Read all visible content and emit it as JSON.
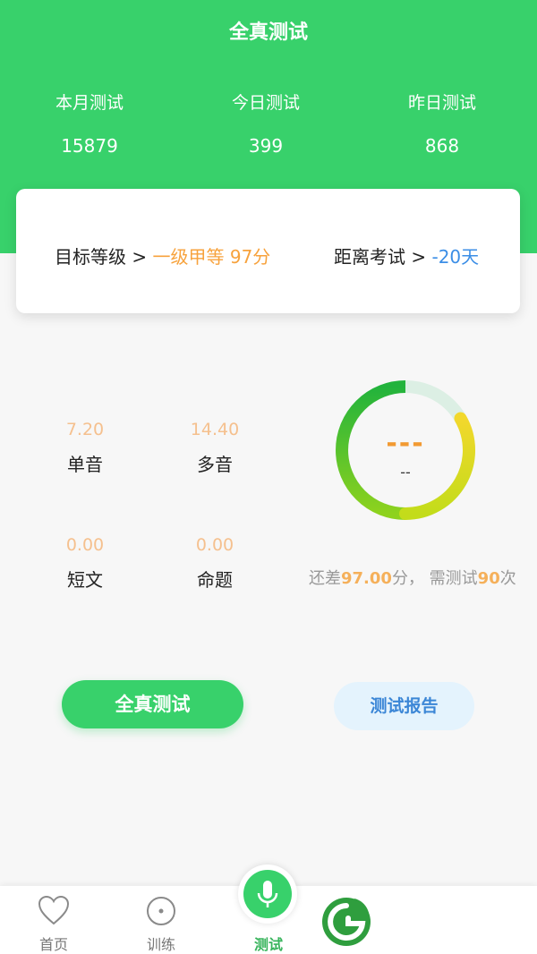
{
  "header": {
    "title": "全真测试",
    "stats": [
      {
        "label": "本月测试",
        "value": "15879"
      },
      {
        "label": "今日测试",
        "value": "399"
      },
      {
        "label": "昨日测试",
        "value": "868"
      }
    ]
  },
  "card": {
    "target_label": "目标等级 > ",
    "target_value": "一级甲等 97分",
    "exam_label": "距离考试 > ",
    "exam_value": "-20天"
  },
  "scores": [
    {
      "value": "7.20",
      "name": "单音"
    },
    {
      "value": "14.40",
      "name": "多音"
    },
    {
      "value": "0.00",
      "name": "短文"
    },
    {
      "value": "0.00",
      "name": "命题"
    }
  ],
  "ring": {
    "dash": "---",
    "sub": "--"
  },
  "remain": {
    "prefix": "还差",
    "points": "97.00",
    "middle": "分， 需测试",
    "times": "90",
    "suffix": "次"
  },
  "buttons": {
    "test": "全真测试",
    "report": "测试报告"
  },
  "tabbar": {
    "items": [
      {
        "label": "首页",
        "icon": "heart-icon"
      },
      {
        "label": "训练",
        "icon": "target-icon"
      },
      {
        "label": "测试",
        "icon": "mic-icon"
      }
    ]
  },
  "colors": {
    "primary": "#38d16b",
    "orange": "#f7a23c",
    "blue": "#3b8ee6"
  }
}
